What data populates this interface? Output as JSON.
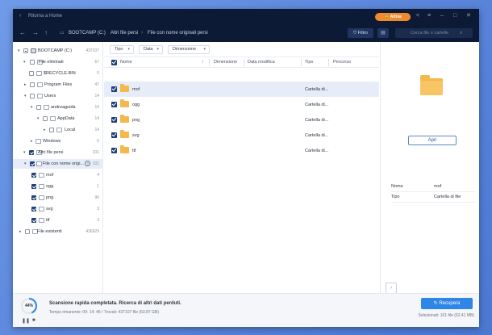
{
  "titlebar": {
    "title": "Ritorna a Home",
    "upgrade_label": "Attiva",
    "icons": [
      "share-icon",
      "menu-icon",
      "minimize-icon",
      "maximize-icon",
      "close-icon"
    ]
  },
  "nav": {
    "breadcrumbs": [
      "BOOTCAMP (C:)",
      "Altri file persi",
      "File con nome originali persi"
    ],
    "filter_label": "Filtro",
    "search_placeholder": "Cerca file o cartelle"
  },
  "tree": {
    "items": [
      {
        "label": "BOOTCAMP (C:)",
        "count": "437107"
      },
      {
        "label": "File eliminati",
        "count": "67"
      },
      {
        "label": "$RECYCLE.BIN",
        "count": "0"
      },
      {
        "label": "Program Files",
        "count": "47"
      },
      {
        "label": "Users",
        "count": "14"
      },
      {
        "label": "andreaguida",
        "count": "14"
      },
      {
        "label": "AppData",
        "count": "14"
      },
      {
        "label": "Local",
        "count": "14"
      },
      {
        "label": "Windows",
        "count": "6"
      },
      {
        "label": "Altri file persi",
        "count": "101"
      },
      {
        "label": "File con nome origi...",
        "count": "101"
      },
      {
        "label": "mof",
        "count": "4"
      },
      {
        "label": "ogg",
        "count": "1"
      },
      {
        "label": "png",
        "count": "90"
      },
      {
        "label": "svg",
        "count": "3"
      },
      {
        "label": "ttf",
        "count": "3"
      },
      {
        "label": "File esistenti",
        "count": "436929"
      }
    ]
  },
  "filters": {
    "tipo": "Tipo",
    "data": "Data",
    "dimensione": "Dimensione"
  },
  "table": {
    "headers": {
      "nome": "Nome",
      "dimensione": "Dimensione",
      "data_modifica": "Data modifica",
      "tipo": "Tipo",
      "percorso": "Percorso"
    },
    "rows": [
      {
        "name": "mof",
        "type": "Cartella di..."
      },
      {
        "name": "ogg",
        "type": "Cartella di..."
      },
      {
        "name": "png",
        "type": "Cartella di..."
      },
      {
        "name": "svg",
        "type": "Cartella di..."
      },
      {
        "name": "ttf",
        "type": "Cartella di..."
      }
    ]
  },
  "preview": {
    "open_label": "Apri",
    "name_key": "Nome",
    "name_value": "mof",
    "type_key": "Tipo",
    "type_value": "Cartella di file"
  },
  "status": {
    "progress_text": "44%",
    "progress": 0.44,
    "line1": "Scansione rapida completata. Ricerca di altri dati perduti.",
    "line2": "Tempo rimanente: 00: 14: 46 / Trovati: 437107 file (63.87 GB)",
    "recover_label": "Recupera",
    "selection_info": "Selezionati: 101 file (52.41 MB)"
  },
  "colors": {
    "titlebar_bg": "#0c1a36",
    "accent": "#2e86e6",
    "upgrade": "#f08a2c",
    "folder": "#f5b84a",
    "checkbox": "#1d3f7a"
  }
}
